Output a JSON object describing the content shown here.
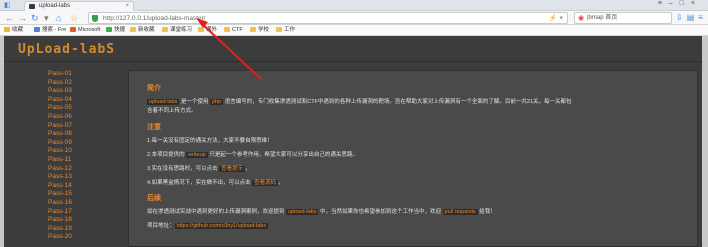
{
  "browser": {
    "tab_title": "upload-labs",
    "url": "http://127.0.0.1/upload-labs-master/",
    "search_text": "|bmap 首页"
  },
  "bookmarks": [
    "收藏",
    "搜索 - Fre",
    "Microsoft",
    "快捷",
    "新收藏",
    "课堂练习",
    "课外",
    "CTF",
    "学校",
    "工作"
  ],
  "logo": "UpLoad-labS",
  "sidebar": {
    "items": [
      "Pass-01",
      "Pass-02",
      "Pass-03",
      "Pass-04",
      "Pass-05",
      "Pass-06",
      "Pass-07",
      "Pass-08",
      "Pass-09",
      "Pass-10",
      "Pass-11",
      "Pass-12",
      "Pass-13",
      "Pass-14",
      "Pass-15",
      "Pass-16",
      "Pass-17",
      "Pass-18",
      "Pass-19",
      "Pass-20"
    ]
  },
  "main": {
    "intro_heading": "简介",
    "intro_line1_pre": "",
    "intro_code1": "upload-labs",
    "intro_line1_mid": " 是一个使用 ",
    "intro_code2": "php",
    "intro_line1_post": " 语言编写的，专门收集渗透测试和CTF中遇到的各种上传漏洞的靶场。旨在帮助大家对上传漏洞有一个全面的了解。目前一共21关，每一关都包",
    "intro_line2": "含着不同上传方式。",
    "notes_heading": "注意",
    "note1": "1.每一关没有固定的通关方法，大家不要自限思维！",
    "note2_pre": "2.本项目提供的 ",
    "note2_code": "writeup",
    "note2_post": " 只是起一个参考作用，希望大家可以分享出自己的通关思路。",
    "note3_pre": "3.实在没有思路时，可以点击 ",
    "note3_code": "查看提示",
    "note3_post": "。",
    "note4_pre": "4.如果黑盒情况下，实在做不出，可以点击 ",
    "note4_code": "查看源码",
    "note4_post": "。",
    "thanks_heading": "后续",
    "thanks_pre": "如在渗透测试实战中遇到更好的上传漏洞案例，欢迎提到 ",
    "thanks_code1": "upload-labs",
    "thanks_mid": " 中，当然如果你也希望参加到这个工作当中，欢迎 ",
    "thanks_code2": "pull requests",
    "thanks_post": " 给我！",
    "project_pre": "项目地址：",
    "project_url": "https://github.com/c0ny1/upload-labs"
  }
}
